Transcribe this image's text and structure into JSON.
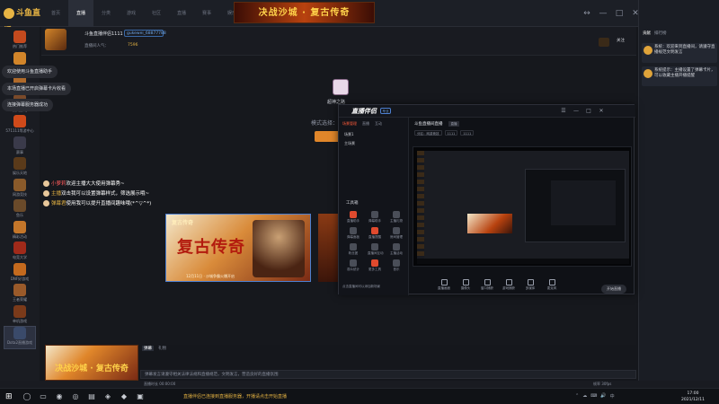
{
  "app": {
    "logo": "斗鱼直播",
    "nav_tabs": [
      "首页",
      "直播",
      "分类",
      "游戏",
      "社区",
      "直播",
      "赛事",
      "娱乐"
    ],
    "active_tab_index": 1,
    "top_banner": "决战沙城 · 复古传奇",
    "window_controls": [
      "↔",
      "—",
      "□",
      "✕"
    ],
    "promos": [
      "观看直播人气PK 主播排名 查看排行",
      "成为用户主播 立即开播"
    ],
    "colors": {
      "accent": "#e0862a",
      "bg": "#15171c",
      "link": "#4d7fd0"
    }
  },
  "right_panel": {
    "tabs": [
      "贡献",
      "排行榜"
    ],
    "messages": [
      "系统：欢迎来到直播间，请遵守直播规范文明发言",
      "系统提示：主播设置了弹幕卡片，可以收藏主播开播提醒"
    ]
  },
  "sidebar": {
    "items": [
      {
        "label": "热门推荐",
        "color": "#c44a1e"
      },
      {
        "label": "我的关注",
        "color": "#d2852a"
      },
      {
        "label": "分区",
        "color": "#b06a2a"
      },
      {
        "label": "热门游戏",
        "color": "#7a4a2a"
      },
      {
        "label": "571111等游中心",
        "color": "#d04a1a"
      },
      {
        "label": "赛事",
        "color": "#3a3a4a"
      },
      {
        "label": "娱乐天地",
        "color": "#5a3a1a"
      },
      {
        "label": "网游竞技",
        "color": "#8a5a2a"
      },
      {
        "label": "鱼乐",
        "color": "#6a4a2a"
      },
      {
        "label": "精彩活动",
        "color": "#c4762a"
      },
      {
        "label": "电竞大学",
        "color": "#a02a1a"
      },
      {
        "label": "DNF好游戏",
        "color": "#c46a1e"
      },
      {
        "label": "王者荣耀",
        "color": "#9a5a2a"
      },
      {
        "label": "单机游戏",
        "color": "#7a3a1a"
      },
      {
        "label": "Dota2直播游戏",
        "color": "#3a4a6a"
      }
    ]
  },
  "toasts": [
    "欢迎使用斗鱼直播助手",
    "本场直播已开启弹幕卡片收看",
    "连接弹幕服务器成功"
  ],
  "streamer": {
    "name": "斗鱼直播伴侣1111",
    "id": "gukewei_68877788",
    "sub_label": "直播间人气：",
    "sub_value": "7596",
    "follow": "关注"
  },
  "stage": {
    "scene_name": "超神之路",
    "mode_label": "模式选择：",
    "danmu": [
      {
        "name": "小萝莉",
        "text": "欢迎主播大大使用弹幕秀~",
        "yellow": false
      },
      {
        "name": "主播",
        "text": "双击我可以设置弹幕样式，筛选展示哦~",
        "yellow": true
      },
      {
        "name": "弹幕君",
        "text": "使用我可以提升直播间趣味哦(*^▽^*)",
        "yellow": true
      }
    ],
    "ad": {
      "title": "复古传奇",
      "main": "复古传奇",
      "foot": "12月11日 · 沙城争霸火爆开启"
    }
  },
  "overlay": {
    "logo": "直播伴侣",
    "badge": "专业",
    "controls": [
      "☰",
      "—",
      "□",
      "✕"
    ],
    "left_tabs": [
      "场景管理",
      "直播",
      "互动"
    ],
    "scenes": [
      "场景1",
      "主场景"
    ],
    "tools_title": "工具箱",
    "tools": [
      {
        "label": "直播助手",
        "red": true
      },
      {
        "label": "弹幕助手",
        "red": false
      },
      {
        "label": "主播礼物",
        "red": false
      },
      {
        "label": "弹幕面板",
        "red": false
      },
      {
        "label": "直播提醒",
        "red": true
      },
      {
        "label": "房间管理",
        "red": false
      },
      {
        "label": "粉丝团",
        "red": false
      },
      {
        "label": "直播间互动",
        "red": false
      },
      {
        "label": "主播活动",
        "red": false
      },
      {
        "label": "观众统计",
        "red": false
      },
      {
        "label": "更多工具",
        "red": true
      },
      {
        "label": "音乐",
        "red": false
      }
    ],
    "left_footer": "点击直播间可以添加新场景",
    "room_title": "斗鱼直播间直播",
    "room_tag": "直播",
    "chips": [
      "分区：网游竞技",
      "1111",
      "1111"
    ],
    "bottom_tools": [
      "直播画面",
      "摄像头",
      "窗口捕获",
      "游戏捕获",
      "多媒体",
      "麦克风"
    ],
    "start_label": "开始直播"
  },
  "bottom": {
    "ad_text": "决战沙城 · 复古传奇",
    "chat_tabs": [
      "弹幕",
      "礼物"
    ],
    "chat_hint": "弹幕发言请遵守相关法律法规和直播规范，文明发言，营造良好的直播氛围",
    "status_left": "直播时长 00:00:00",
    "status_right": "帧率 30fps"
  },
  "taskbar": {
    "start": "⊞",
    "icons": [
      "◯",
      "▭",
      "◉",
      "◎",
      "▤",
      "◈",
      "◆",
      "▣"
    ],
    "notice": "直播伴侣已连接到直播服务器，开播请点击开始直播",
    "tray": [
      "⌃",
      "☁",
      "⌨",
      "🔊",
      "中"
    ],
    "time": "17:00",
    "date": "2021/12/11"
  }
}
